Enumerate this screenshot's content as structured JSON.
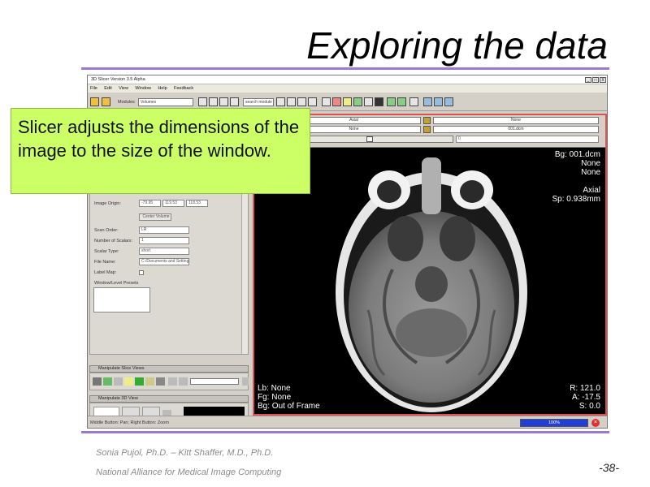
{
  "slide": {
    "title": "Exploring the data",
    "footer_authors": "Sonia Pujol, Ph.D. – Kitt Shaffer, M.D., Ph.D.",
    "footer_org": "National Alliance for Medical Image Computing",
    "page_number": "-38-",
    "accent_color": "#9a7ad0"
  },
  "callout": {
    "text": "Slicer adjusts the dimensions of the image to the size of the window.",
    "background": "#ccff66"
  },
  "app": {
    "window_title": "3D Slicer Version 3.5 Alpha",
    "window_buttons": [
      "_",
      "□",
      "X"
    ],
    "menu": [
      "File",
      "Edit",
      "View",
      "Window",
      "Help",
      "Feedback"
    ],
    "toolbar": {
      "modules_label": "Modules",
      "module_value": "Volumes",
      "search_placeholder": "search module"
    },
    "volume_info": {
      "image_origin_label": "Image Origin:",
      "image_origin": [
        "-79.95",
        "119.53",
        "118.53"
      ],
      "center_volume_button": "Center Volume",
      "scan_order_label": "Scan Order:",
      "scan_order": "LR",
      "num_scalars_label": "Number of Scalars:",
      "num_scalars": "1",
      "scalar_type_label": "Scalar Type:",
      "scalar_type": "short",
      "file_name_label": "File Name:",
      "file_name": "C:/Documents and Settings",
      "label_map_label": "Label Map:",
      "window_level_label": "Window/Level Presets"
    },
    "sections": {
      "manipulate_slice": "Manipulate Slice Views",
      "manipulate_3d": "Manipulate 3D View"
    },
    "viewer": {
      "orientation": "Axial",
      "fg_select": "None",
      "bg_select": "None",
      "bg_select_2": "001.dcm",
      "slider_value": "0",
      "overlay_top_right": [
        "Bg: 001.dcm",
        "None",
        "None",
        "",
        "Axial",
        "Sp: 0.938mm"
      ],
      "overlay_bottom_left": [
        "Lb: None",
        "Fg: None",
        "Bg: Out of Frame"
      ],
      "overlay_bottom_right": [
        "R: 121.0",
        "A: -17.5",
        "S: 0.0"
      ]
    },
    "status": {
      "text": "Middle Button: Pan; Right Button: Zoom",
      "progress_label": "100%",
      "progress": 1.0
    }
  }
}
